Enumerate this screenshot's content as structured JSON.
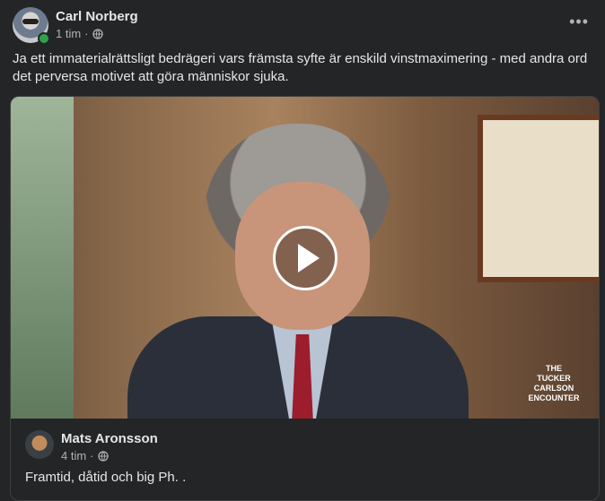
{
  "post": {
    "author": "Carl Norberg",
    "time": "1 tim",
    "separator": "·",
    "privacy_icon": "globe-icon",
    "more_label": "•••",
    "text": "Ja ett immaterialrättsligt bedrägeri vars främsta syfte är enskild vinstmaximering - med andra ord det perversa motivet att göra människor sjuka."
  },
  "shared_post": {
    "video_logo_lines": [
      "THE",
      "TUCKER CARLSON",
      "ENCOUNTER"
    ],
    "author": "Mats Aronsson",
    "time": "4 tim",
    "separator": "·",
    "privacy_icon": "globe-icon",
    "text": "Framtid, dåtid och big Ph. ."
  },
  "colors": {
    "background": "#242526",
    "text": "#e4e6eb",
    "secondary_text": "#b0b3b8",
    "online": "#31a24c"
  }
}
